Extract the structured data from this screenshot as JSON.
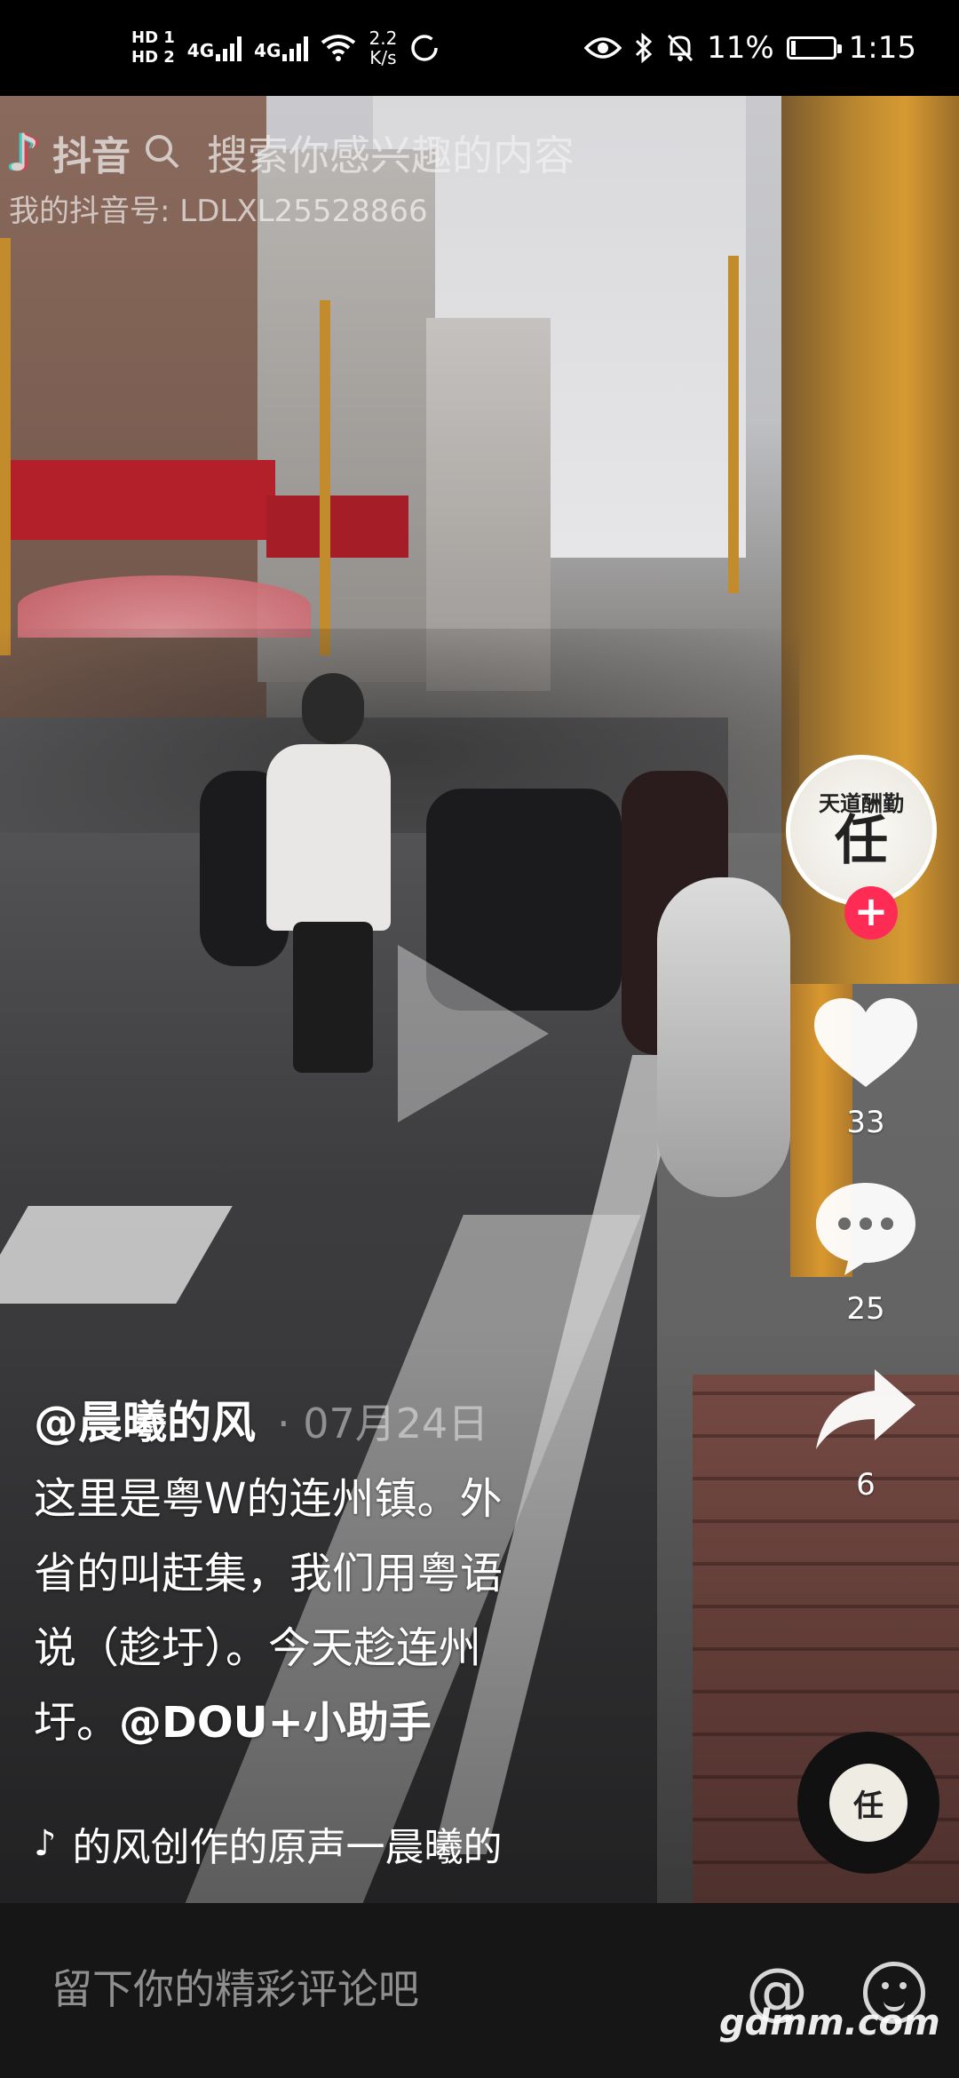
{
  "status_bar": {
    "hd1": "HD 1",
    "hd2": "HD 2",
    "net1": "4G",
    "net2": "4G",
    "speed_value": "2.2",
    "speed_unit": "K/s",
    "battery_percent": "11%",
    "battery_level": 0.11,
    "time": "1:15"
  },
  "watermark": {
    "brand": "抖音",
    "search_text": "搜索你感兴趣的内容",
    "douyin_id": "我的抖音号: LDLXL25528866"
  },
  "avatar_text": "任",
  "avatar_caption": "天道酬勤",
  "actions": {
    "likes": "33",
    "comments": "25",
    "shares": "6"
  },
  "caption": {
    "author": "@晨曦的风",
    "date": "· 07月24日",
    "desc_line1": "这里是粤W的连州镇。外",
    "desc_line2": "省的叫赶集，我们用粤语",
    "desc_line3": "说（趁圩）。今天趁连州",
    "desc_line4_prefix": "圩。",
    "mention": "@DOU+小助手"
  },
  "music": {
    "text": "的风创作的原声一晨曦的"
  },
  "disc_text": "任",
  "comment_bar": {
    "placeholder": "留下你的精彩评论吧",
    "site_watermark": "gdmm.com"
  },
  "colors": {
    "accent_red": "#fe2c55",
    "tiktok_cyan": "#25f4ee",
    "comment_bar_bg": "#161616"
  },
  "icons": [
    "eye-icon",
    "bluetooth-icon",
    "mute-icon",
    "battery-icon",
    "wifi-icon",
    "search-icon",
    "play-icon",
    "heart-icon",
    "comment-icon",
    "share-icon",
    "music-note-icon",
    "at-icon",
    "emoji-icon"
  ]
}
